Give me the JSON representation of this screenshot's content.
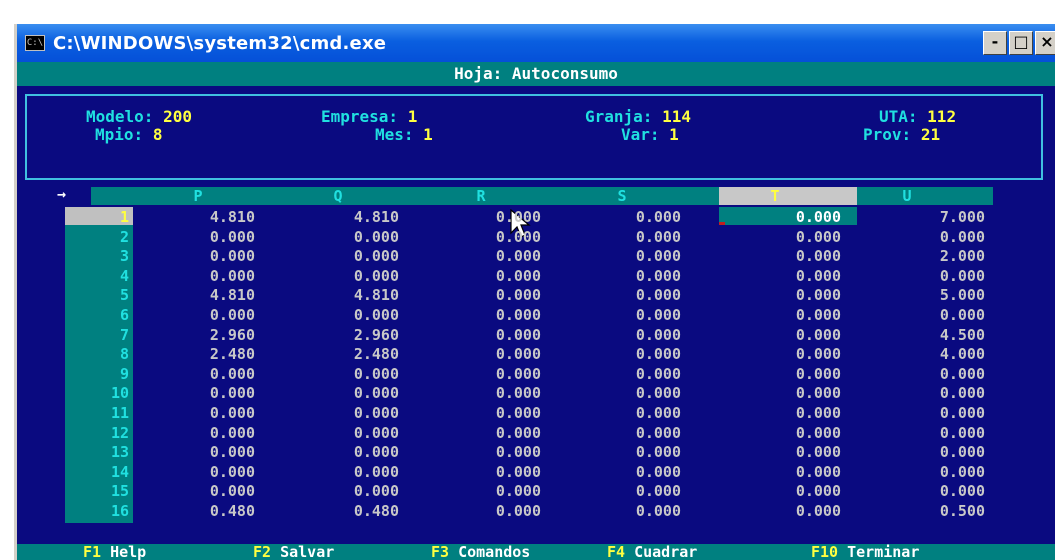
{
  "window": {
    "title": "C:\\WINDOWS\\system32\\cmd.exe",
    "icon": "cmd-icon",
    "buttons": [
      "-",
      "□",
      "×"
    ]
  },
  "sheet": {
    "title": "Hoja: Autoconsumo"
  },
  "info": {
    "modelo": {
      "label": "Modelo:",
      "value": "200"
    },
    "mpio": {
      "label": "Mpio:",
      "value": "8"
    },
    "empresa": {
      "label": "Empresa:",
      "value": "1"
    },
    "mes": {
      "label": "Mes:",
      "value": "1"
    },
    "granja": {
      "label": "Granja:",
      "value": "114"
    },
    "var": {
      "label": "Var:",
      "value": "1"
    },
    "uta": {
      "label": "UTA:",
      "value": "112"
    },
    "prov": {
      "label": "Prov:",
      "value": "21"
    }
  },
  "grid": {
    "arrow": "→",
    "columns": [
      "P",
      "Q",
      "R",
      "S",
      "T",
      "U"
    ],
    "active_column": "T",
    "active_row": "1",
    "rows": [
      {
        "n": "1",
        "cells": [
          "4.810",
          "4.810",
          "0.000",
          "0.000",
          "0.000",
          "7.000"
        ]
      },
      {
        "n": "2",
        "cells": [
          "0.000",
          "0.000",
          "0.000",
          "0.000",
          "0.000",
          "0.000"
        ]
      },
      {
        "n": "3",
        "cells": [
          "0.000",
          "0.000",
          "0.000",
          "0.000",
          "0.000",
          "2.000"
        ]
      },
      {
        "n": "4",
        "cells": [
          "0.000",
          "0.000",
          "0.000",
          "0.000",
          "0.000",
          "0.000"
        ]
      },
      {
        "n": "5",
        "cells": [
          "4.810",
          "4.810",
          "0.000",
          "0.000",
          "0.000",
          "5.000"
        ]
      },
      {
        "n": "6",
        "cells": [
          "0.000",
          "0.000",
          "0.000",
          "0.000",
          "0.000",
          "0.000"
        ]
      },
      {
        "n": "7",
        "cells": [
          "2.960",
          "2.960",
          "0.000",
          "0.000",
          "0.000",
          "4.500"
        ]
      },
      {
        "n": "8",
        "cells": [
          "2.480",
          "2.480",
          "0.000",
          "0.000",
          "0.000",
          "4.000"
        ]
      },
      {
        "n": "9",
        "cells": [
          "0.000",
          "0.000",
          "0.000",
          "0.000",
          "0.000",
          "0.000"
        ]
      },
      {
        "n": "10",
        "cells": [
          "0.000",
          "0.000",
          "0.000",
          "0.000",
          "0.000",
          "0.000"
        ]
      },
      {
        "n": "11",
        "cells": [
          "0.000",
          "0.000",
          "0.000",
          "0.000",
          "0.000",
          "0.000"
        ]
      },
      {
        "n": "12",
        "cells": [
          "0.000",
          "0.000",
          "0.000",
          "0.000",
          "0.000",
          "0.000"
        ]
      },
      {
        "n": "13",
        "cells": [
          "0.000",
          "0.000",
          "0.000",
          "0.000",
          "0.000",
          "0.000"
        ]
      },
      {
        "n": "14",
        "cells": [
          "0.000",
          "0.000",
          "0.000",
          "0.000",
          "0.000",
          "0.000"
        ]
      },
      {
        "n": "15",
        "cells": [
          "0.000",
          "0.000",
          "0.000",
          "0.000",
          "0.000",
          "0.000"
        ]
      },
      {
        "n": "16",
        "cells": [
          "0.480",
          "0.480",
          "0.000",
          "0.000",
          "0.000",
          "0.500"
        ]
      }
    ]
  },
  "function_keys": [
    {
      "key": "F1",
      "label": "Help"
    },
    {
      "key": "F2",
      "label": "Salvar"
    },
    {
      "key": "F3",
      "label": "Comandos"
    },
    {
      "key": "F4",
      "label": "Cuadrar"
    },
    {
      "key": "F10",
      "label": "Terminar"
    }
  ],
  "colors": {
    "background": "#0a0a80",
    "teal": "#008080",
    "label": "#20e0e0",
    "value": "#ffff40",
    "cell": "#c8c8c8"
  }
}
